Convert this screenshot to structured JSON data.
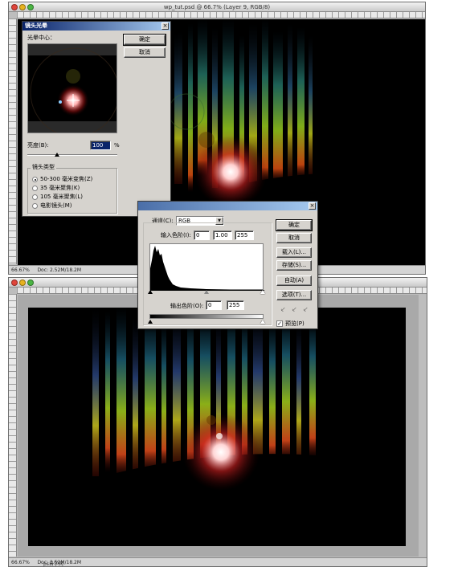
{
  "top_window": {
    "title": "wp_tut.psd @ 66.7% (Layer 9, RGB/8)",
    "status_zoom": "66.67%",
    "status_doc": "Doc: 2.52M/18.2M"
  },
  "bottom_window": {
    "status_zoom": "66.67%",
    "status_doc": "Doc: 2.52M/18.2M"
  },
  "lens_flare": {
    "title": "镜头光晕",
    "flare_center_label": "光晕中心：",
    "brightness_label": "亮度(B):",
    "brightness_value": "100",
    "brightness_unit": "%",
    "lens_type_label": "镜头类型",
    "lens_types": [
      {
        "label": "50-300 毫米变焦(Z)",
        "selected": true
      },
      {
        "label": "35 毫米聚焦(K)",
        "selected": false
      },
      {
        "label": "105 毫米聚焦(L)",
        "selected": false
      },
      {
        "label": "电影镜头(M)",
        "selected": false
      }
    ],
    "ok_label": "确定",
    "cancel_label": "取消",
    "brightness_level": 0.33
  },
  "levels": {
    "channel_label": "通道(C):",
    "channel_value": "RGB",
    "input_levels_label": "输入色阶(I):",
    "input_levels": [
      "0",
      "1.00",
      "255"
    ],
    "output_levels_label": "输出色阶(O):",
    "output_levels": [
      "0",
      "255"
    ],
    "buttons": {
      "ok": "确定",
      "cancel": "取消",
      "load": "载入(L)...",
      "save": "存储(S)...",
      "auto": "自动(A)",
      "options": "选项(T)..."
    },
    "preview_label": "预览(P)",
    "preview_checked": true
  },
  "bottom_caption": "ps自学网"
}
